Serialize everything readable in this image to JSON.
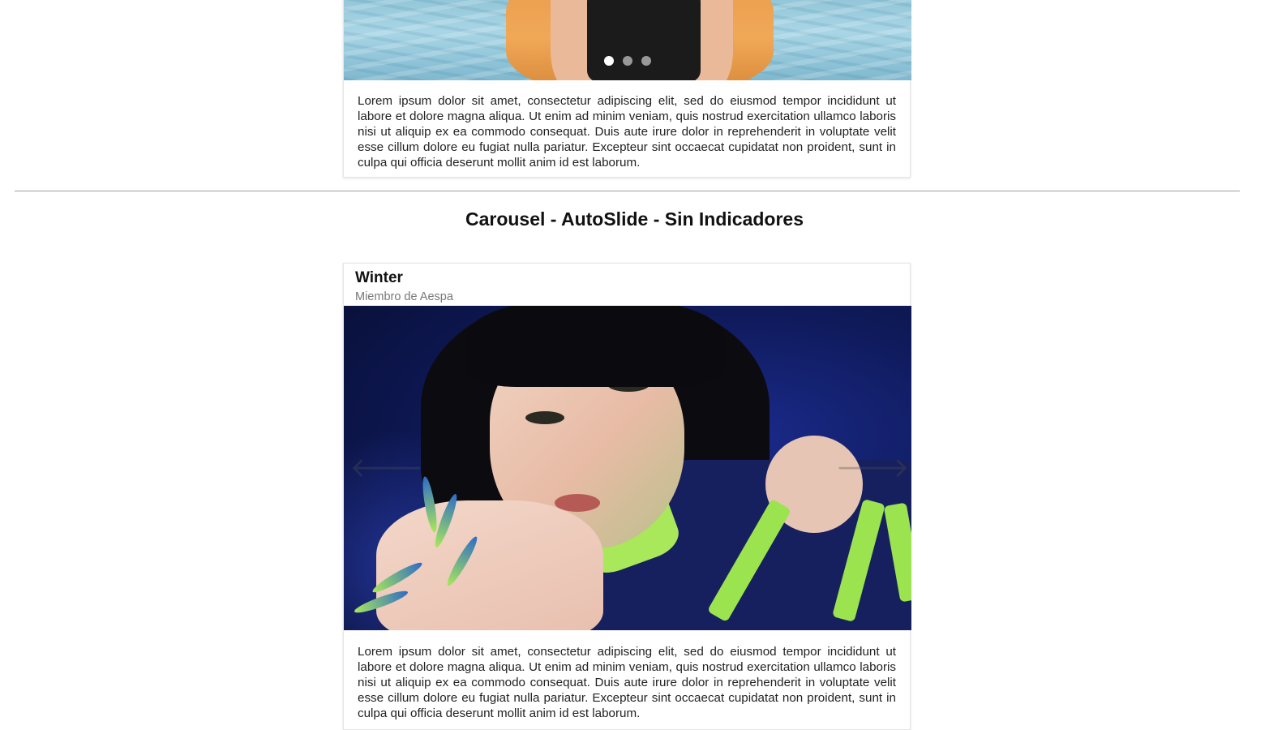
{
  "section_title": "Carousel - AutoSlide - Sin Indicadores",
  "card_1": {
    "image": "orange-hair-model-photo",
    "indicators": {
      "count": 3,
      "active_index": 0
    },
    "body_text": "Lorem ipsum dolor sit amet, consectetur adipiscing elit, sed do eiusmod tempor incididunt ut labore et dolore magna aliqua. Ut enim ad minim veniam, quis nostrud exercitation ullamco laboris nisi ut aliquip ex ea commodo consequat. Duis aute irure dolor in reprehenderit in voluptate velit esse cillum dolore eu fugiat nulla pariatur. Excepteur sint occaecat cupidatat non proident, sunt in culpa qui officia deserunt mollit anim id est laborum."
  },
  "card_2": {
    "title": "Winter",
    "subtitle": "Miembro de Aespa",
    "image": "winter-aespa-photo",
    "prev_icon": "arrow-left-icon",
    "next_icon": "arrow-right-icon",
    "prev_glyph": "🡐",
    "next_glyph": "🡒",
    "body_text": "Lorem ipsum dolor sit amet, consectetur adipiscing elit, sed do eiusmod tempor incididunt ut labore et dolore magna aliqua. Ut enim ad minim veniam, quis nostrud exercitation ullamco laboris nisi ut aliquip ex ea commodo consequat. Duis aute irure dolor in reprehenderit in voluptate velit esse cillum dolore eu fugiat nulla pariatur. Excepteur sint occaecat cupidatat non proident, sunt in culpa qui officia deserunt mollit anim id est laborum."
  },
  "colors": {
    "indicator_active": "#ffffff",
    "divider": "#9e9e9e",
    "subtitle": "#777777"
  }
}
